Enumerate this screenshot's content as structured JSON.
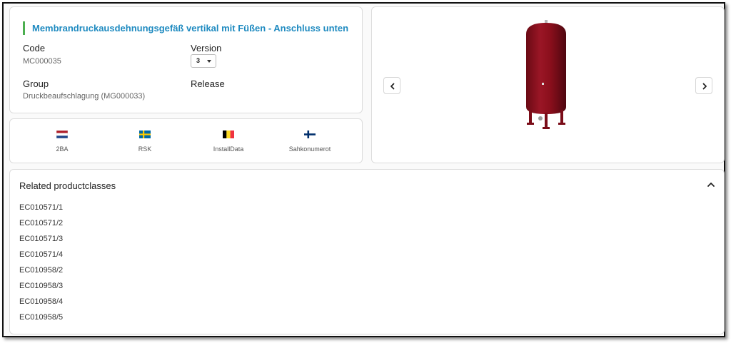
{
  "product": {
    "title": "Membrandruckausdehnungsgefäß vertikal mit Füßen - Anschluss unten",
    "code_label": "Code",
    "code_value": "MC000035",
    "version_label": "Version",
    "version_value": "3",
    "group_label": "Group",
    "group_value": "Druckbeaufschlagung (MG000033)",
    "release_label": "Release",
    "title_accent_color": "#4caf50",
    "title_color": "#1e8ac0"
  },
  "code_systems": [
    {
      "label": "2BA",
      "flag": "netherlands-flag-icon"
    },
    {
      "label": "RSK",
      "flag": "sweden-flag-icon"
    },
    {
      "label": "InstallData",
      "flag": "belgium-flag-icon"
    },
    {
      "label": "Sahkonumerot",
      "flag": "finland-flag-icon"
    }
  ],
  "image_viewer": {
    "prev_icon": "chevron-left-icon",
    "next_icon": "chevron-right-icon",
    "image": "red-expansion-vessel-image",
    "vessel_color": "#8b0f1c"
  },
  "related": {
    "header": "Related productclasses",
    "toggle_icon": "chevron-up-icon",
    "items": [
      "EC010571/1",
      "EC010571/2",
      "EC010571/3",
      "EC010571/4",
      "EC010958/2",
      "EC010958/3",
      "EC010958/4",
      "EC010958/5"
    ]
  }
}
